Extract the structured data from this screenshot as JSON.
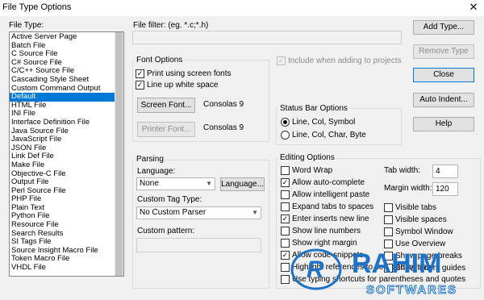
{
  "window": {
    "title": "File Type Options",
    "close_glyph": "✕"
  },
  "file_type": {
    "label": "File Type:",
    "items": [
      "Active Server Page",
      "Batch File",
      "C Source File",
      "C# Source File",
      "C/C++ Source File",
      "Cascading Style Sheet",
      "Custom Command Output",
      "Default",
      "HTML File",
      "INI File",
      "Interface Definition File",
      "Java Source File",
      "JavaScript File",
      "JSON File",
      "Link Def File",
      "Make File",
      "Objective-C File",
      "Output File",
      "Perl Source File",
      "PHP File",
      "Plain Text",
      "Python File",
      "Resource File",
      "Search Results",
      "SI Tags File",
      "Source Insight Macro File",
      "Token Macro File",
      "VHDL File"
    ],
    "selected": "Default"
  },
  "file_filter": {
    "label": "File filter: (eg. *.c;*.h)",
    "value": ""
  },
  "include_projects": {
    "label": "Include when adding to projects",
    "checked": true
  },
  "buttons": {
    "add_type": "Add Type...",
    "remove_type": "Remove Type",
    "close": "Close",
    "auto_indent": "Auto Indent...",
    "help": "Help"
  },
  "font_options": {
    "title": "Font Options",
    "print_screen_fonts": {
      "label": "Print using screen fonts",
      "checked": true
    },
    "line_up_white_space": {
      "label": "Line up white space",
      "checked": true
    },
    "screen_font_button": "Screen Font...",
    "screen_font_value": "Consolas 9",
    "printer_font_button": "Printer Font...",
    "printer_font_value": "Consolas 9"
  },
  "status_bar": {
    "title": "Status Bar Options",
    "options": [
      {
        "label": "Line, Col, Symbol",
        "selected": true
      },
      {
        "label": "Line, Col, Char, Byte",
        "selected": false
      }
    ]
  },
  "parsing": {
    "title": "Parsing",
    "language_label": "Language:",
    "language_value": "None",
    "language_button": "Language...",
    "custom_tag_label": "Custom Tag Type:",
    "custom_tag_value": "No Custom Parser",
    "custom_pattern_label": "Custom pattern:",
    "custom_pattern_value": ""
  },
  "editing": {
    "title": "Editing Options",
    "left": [
      {
        "label": "Word Wrap",
        "checked": false
      },
      {
        "label": "Allow auto-complete",
        "checked": true
      },
      {
        "label": "Allow intelligent paste",
        "checked": false
      },
      {
        "label": "Expand tabs to spaces",
        "checked": false
      },
      {
        "label": "Enter inserts new line",
        "checked": true
      },
      {
        "label": "Show line numbers",
        "checked": false
      },
      {
        "label": "Show right margin",
        "checked": false
      },
      {
        "label": "Allow code snippets",
        "checked": true
      },
      {
        "label": "Highlight references to selected symbol",
        "checked": false
      },
      {
        "label": "Use typing shortcuts for parentheses and quotes",
        "checked": false
      }
    ],
    "tab_width_label": "Tab width:",
    "tab_width_value": "4",
    "margin_width_label": "Margin width:",
    "margin_width_value": "120",
    "right": [
      {
        "label": "Visible tabs",
        "checked": false
      },
      {
        "label": "Visible spaces",
        "checked": false
      },
      {
        "label": "Symbol Window",
        "checked": false
      },
      {
        "label": "Use Overview",
        "checked": false
      },
      {
        "label": "Show page breaks",
        "checked": false
      },
      {
        "label": "Show indent guides",
        "checked": false
      }
    ]
  },
  "watermark": {
    "text_top": "RAHIM",
    "text_bottom": "SOFTWARES",
    "color_top": "#1e73c8",
    "color_bottom": "#ffffff",
    "outline": "#1e73c8"
  },
  "check_glyph": "✓"
}
